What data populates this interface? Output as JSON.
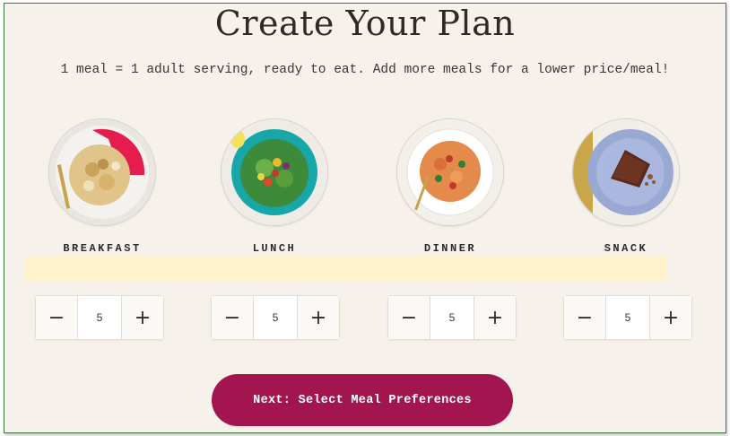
{
  "page": {
    "title": "Create Your Plan",
    "subtitle": "1 meal = 1 adult serving, ready to eat. Add more meals for a lower price/meal!"
  },
  "meals": [
    {
      "label": "BREAKFAST",
      "quantity": "5",
      "image": "breakfast-bowl-image"
    },
    {
      "label": "LUNCH",
      "quantity": "5",
      "image": "lunch-salad-image"
    },
    {
      "label": "DINNER",
      "quantity": "5",
      "image": "dinner-pasta-image"
    },
    {
      "label": "SNACK",
      "quantity": "5",
      "image": "snack-brownie-image"
    }
  ],
  "stepper": {
    "minus": "−",
    "plus": "+"
  },
  "next_button": {
    "label": "Next: Select Meal Preferences"
  },
  "colors": {
    "background": "#f6f1ea",
    "accent": "#a3154e",
    "highlight": "#fff2cc",
    "frame_border": "#3f7a45"
  }
}
